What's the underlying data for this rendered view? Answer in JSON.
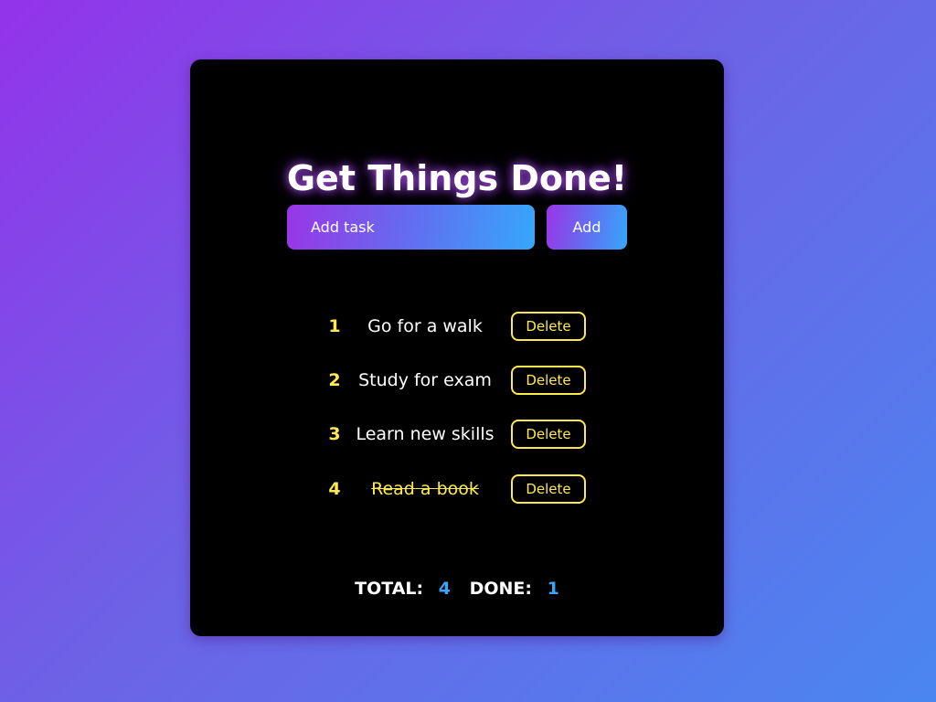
{
  "header": {
    "title": "Get Things Done!"
  },
  "form": {
    "input_placeholder": "Add task",
    "input_value": "",
    "add_label": "Add"
  },
  "tasks": [
    {
      "number": "1",
      "text": "Go for a walk",
      "done": false,
      "delete_label": "Delete"
    },
    {
      "number": "2",
      "text": "Study for exam",
      "done": false,
      "delete_label": "Delete"
    },
    {
      "number": "3",
      "text": "Learn new skills",
      "done": false,
      "delete_label": "Delete"
    },
    {
      "number": "4",
      "text": "Read a book",
      "done": true,
      "delete_label": "Delete"
    }
  ],
  "summary": {
    "total_label": "TOTAL:",
    "total_value": "4",
    "done_label": "DONE:",
    "done_value": "1"
  },
  "colors": {
    "background_start": "#9333ea",
    "background_end": "#4a86f0",
    "card": "#000000",
    "accent_yellow": "#ffe94d",
    "accent_blue": "#3ba4f6"
  }
}
